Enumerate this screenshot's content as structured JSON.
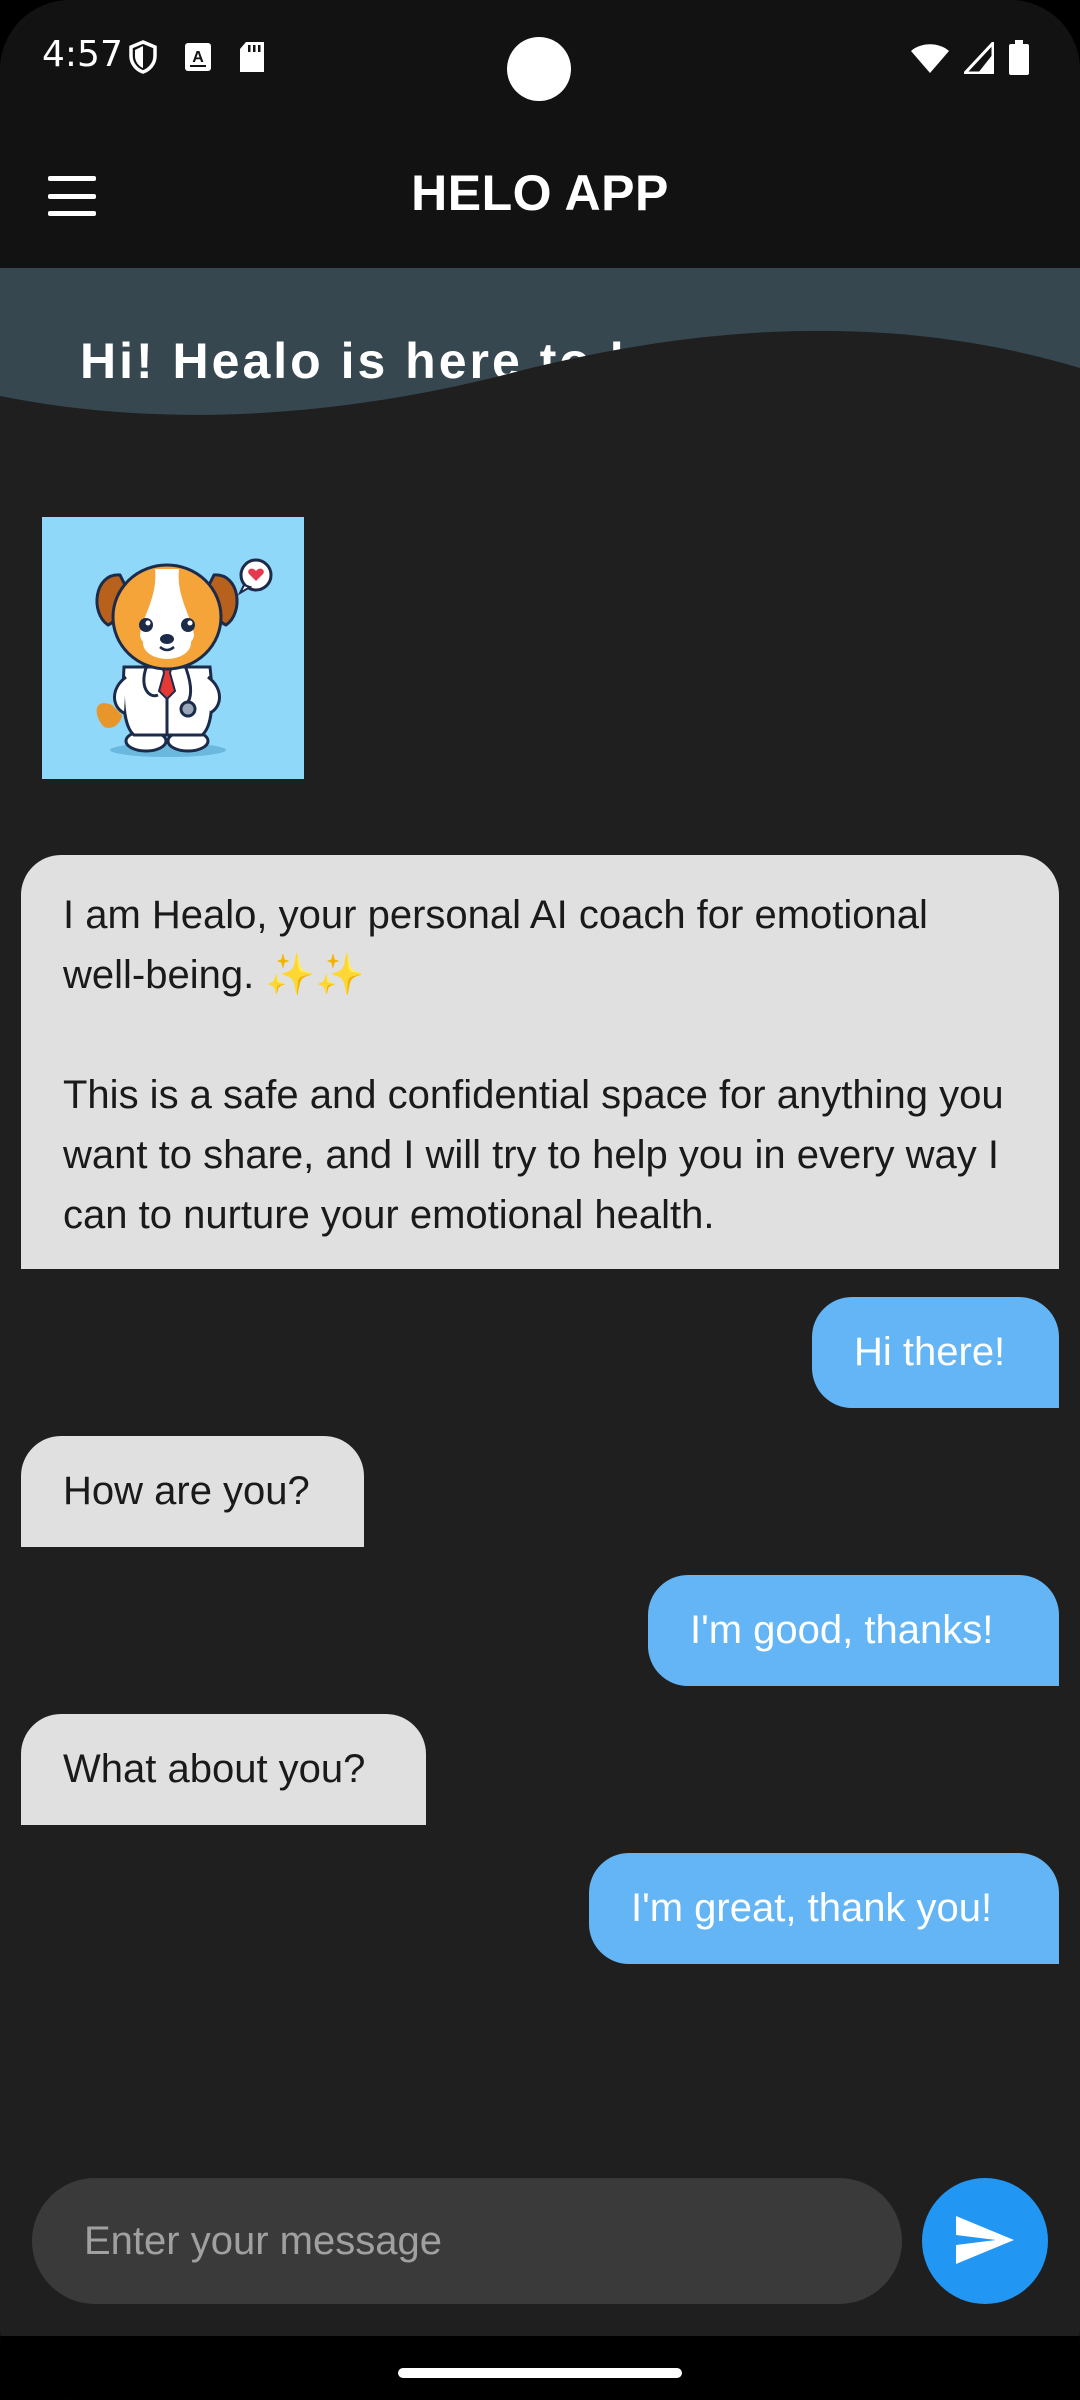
{
  "status_bar": {
    "time": "4:57",
    "left_icons": [
      "shield-icon",
      "keyboard-a-icon",
      "sd-card-icon"
    ],
    "right_icons": [
      "wifi-icon",
      "signal-icon",
      "battery-icon"
    ]
  },
  "app_bar": {
    "title": "HELO APP",
    "menu_icon": "hamburger-menu-icon"
  },
  "banner": {
    "text": "Hi! Healo is here to help you"
  },
  "avatar": {
    "icon": "dog-doctor-avatar"
  },
  "messages": [
    {
      "sender": "bot",
      "paragraphs": [
        "I am Healo, your personal AI coach for emotional well-being. ✨✨",
        "This is a safe and confidential space for anything you want to share, and I will try to help you in every way I can to nurture your emotional health."
      ]
    },
    {
      "sender": "user",
      "text": "Hi there!"
    },
    {
      "sender": "bot",
      "text": "How are you?"
    },
    {
      "sender": "user",
      "text": "I'm good, thanks!"
    },
    {
      "sender": "bot",
      "text": "What about you?"
    },
    {
      "sender": "user",
      "text": "I'm great, thank you!"
    }
  ],
  "composer": {
    "placeholder": "Enter your message",
    "value": "",
    "send_icon": "send-icon"
  },
  "colors": {
    "background": "#1f1f1f",
    "app_bar": "#121212",
    "banner": "#37474f",
    "bot_bubble": "#e0e0e0",
    "user_bubble": "#64b5f6",
    "send_button": "#2196f3",
    "input_bg": "#3a3a3a"
  }
}
